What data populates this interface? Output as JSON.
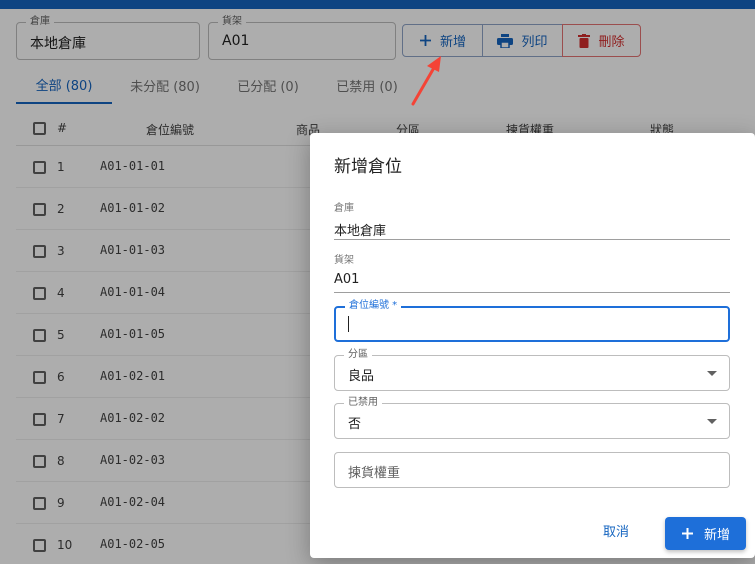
{
  "filters": {
    "warehouse": {
      "label": "倉庫",
      "value": "本地倉庫"
    },
    "shelf": {
      "label": "貨架",
      "value": "A01"
    }
  },
  "actions": {
    "add": "新增",
    "print": "列印",
    "delete": "刪除"
  },
  "tabs": [
    {
      "label": "全部 (80)"
    },
    {
      "label": "未分配 (80)"
    },
    {
      "label": "已分配 (0)"
    },
    {
      "label": "已禁用 (0)"
    }
  ],
  "table": {
    "headers": {
      "num": "#",
      "code": "倉位編號",
      "product": "商品",
      "zone": "分區",
      "weight": "揀貨權重",
      "status": "狀態"
    },
    "rows": [
      {
        "num": "1",
        "code": "A01-01-01"
      },
      {
        "num": "2",
        "code": "A01-01-02"
      },
      {
        "num": "3",
        "code": "A01-01-03"
      },
      {
        "num": "4",
        "code": "A01-01-04"
      },
      {
        "num": "5",
        "code": "A01-01-05"
      },
      {
        "num": "6",
        "code": "A01-02-01"
      },
      {
        "num": "7",
        "code": "A01-02-02"
      },
      {
        "num": "8",
        "code": "A01-02-03"
      },
      {
        "num": "9",
        "code": "A01-02-04"
      },
      {
        "num": "10",
        "code": "A01-02-05"
      }
    ]
  },
  "dialog": {
    "title": "新增倉位",
    "warehouse": {
      "label": "倉庫",
      "value": "本地倉庫"
    },
    "shelf": {
      "label": "貨架",
      "value": "A01"
    },
    "code": {
      "label": "倉位編號 *",
      "value": ""
    },
    "zone": {
      "label": "分區",
      "value": "良品"
    },
    "disabled": {
      "label": "已禁用",
      "value": "否"
    },
    "weight": {
      "placeholder": "揀貨權重"
    },
    "cancel": "取消",
    "submit": "新增"
  },
  "colors": {
    "primary": "#1565c0",
    "danger": "#d32f2f",
    "annotation_arrow": "#f44336"
  }
}
